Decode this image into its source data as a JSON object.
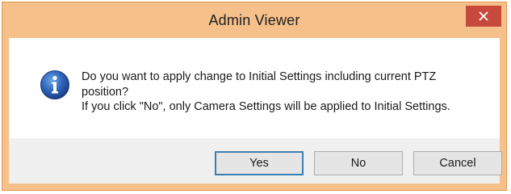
{
  "dialog": {
    "title": "Admin Viewer",
    "close_icon": "close-icon",
    "icon": "info-icon",
    "message_lines": [
      "Do you want to apply change to Initial Settings including current PTZ",
      "position?",
      "If you click \"No\", only Camera Settings will be applied to Initial Settings."
    ],
    "buttons": {
      "yes": "Yes",
      "no": "No",
      "cancel": "Cancel"
    }
  },
  "colors": {
    "titlebar": "#f5c08a",
    "close_button": "#c7493c",
    "default_button_border": "#3c7fb1",
    "button_area": "#f0f0f0"
  }
}
